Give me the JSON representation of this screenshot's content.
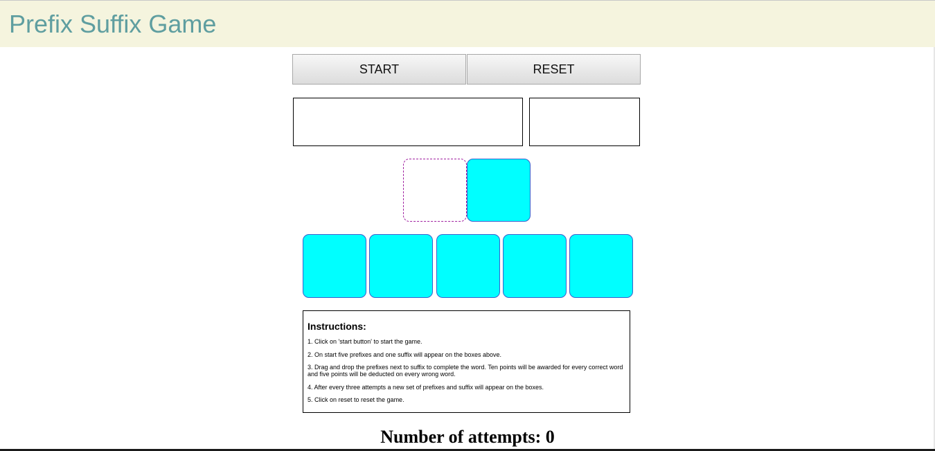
{
  "header": {
    "title": "Prefix Suffix Game"
  },
  "controls": {
    "start_label": "START",
    "reset_label": "RESET"
  },
  "display": {
    "word": "",
    "score": ""
  },
  "game": {
    "drop_slot": "",
    "suffix": "",
    "prefixes": [
      "",
      "",
      "",
      "",
      ""
    ]
  },
  "instructions": {
    "title": "Instructions:",
    "steps": [
      "1. Click on 'start button' to start the game.",
      "2. On start five prefixes and one suffix will appear on the boxes above.",
      "3. Drag and drop the prefixes next to suffix to complete the word. Ten points will be awarded for every correct word and five points will be deducted on every wrong word.",
      "4. After every three attempts a new set of prefixes and suffix will appear on the boxes.",
      "5. Click on reset to reset the game."
    ]
  },
  "attempts": {
    "text": "Number of attempts: 0"
  },
  "colors": {
    "header_bg": "#f5f4de",
    "title_color": "#5f9ea0",
    "tile_fill": "#00ffff",
    "tile_border": "#3a5fcd",
    "drop_border": "#a020a0"
  }
}
